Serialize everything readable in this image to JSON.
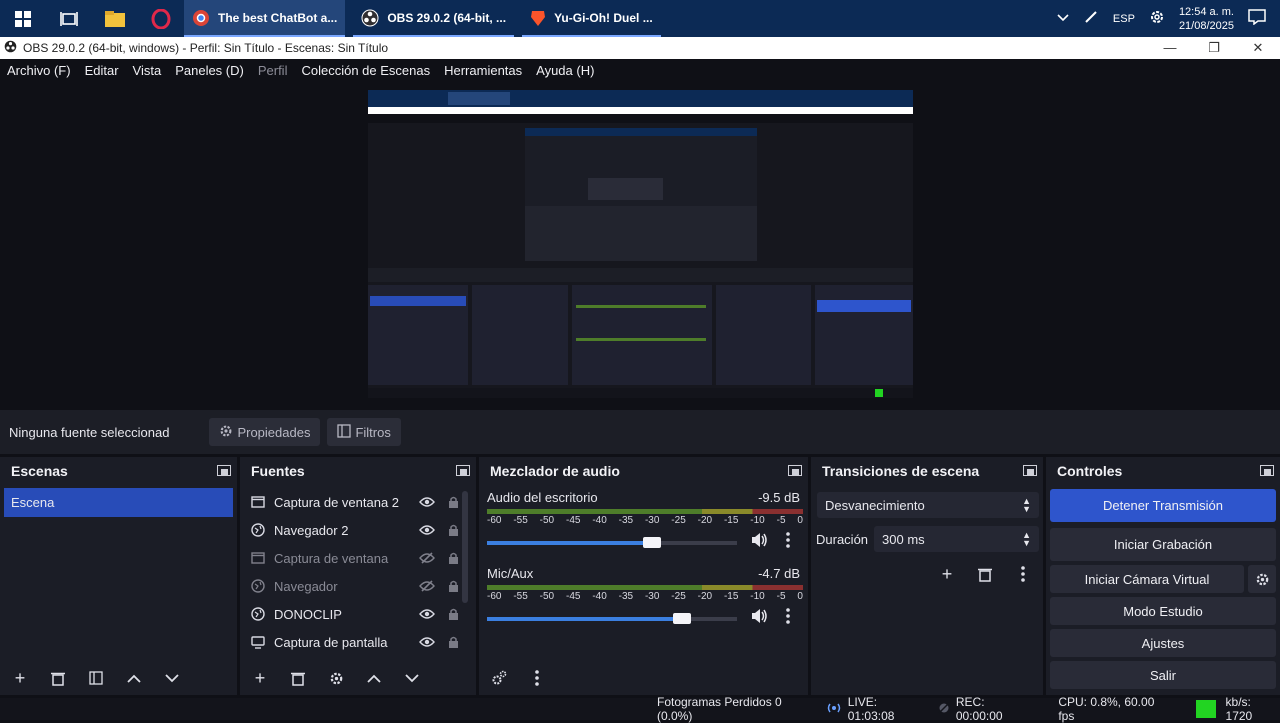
{
  "taskbar": {
    "tasks": [
      {
        "label": "The best ChatBot a..."
      },
      {
        "label": "OBS 29.0.2 (64-bit, ..."
      },
      {
        "label": "Yu-Gi-Oh! Duel ..."
      }
    ],
    "lang": "ESP",
    "time": "12:54 a. m.",
    "date": "21/08/2025"
  },
  "window": {
    "title": "OBS 29.0.2 (64-bit, windows) - Perfil: Sin Título - Escenas: Sin Título",
    "minimize": "—",
    "maximize": "❐",
    "close": "✕"
  },
  "menu": {
    "items": [
      {
        "label": "Archivo (F)"
      },
      {
        "label": "Editar"
      },
      {
        "label": "Vista"
      },
      {
        "label": "Paneles (D)"
      },
      {
        "label": "Perfil"
      },
      {
        "label": "Colección de Escenas"
      },
      {
        "label": "Herramientas"
      },
      {
        "label": "Ayuda (H)"
      }
    ]
  },
  "source_toolbar": {
    "no_source": "Ninguna fuente seleccionad",
    "properties": "Propiedades",
    "filters": "Filtros"
  },
  "scenes": {
    "title": "Escenas",
    "items": [
      {
        "label": "Escena"
      }
    ]
  },
  "sources": {
    "title": "Fuentes",
    "items": [
      {
        "label": "Captura de ventana 2",
        "icon": "window-capture-icon",
        "visible": true
      },
      {
        "label": "Navegador 2",
        "icon": "browser-icon",
        "visible": true
      },
      {
        "label": "Captura de ventana",
        "icon": "window-capture-icon",
        "visible": false
      },
      {
        "label": "Navegador",
        "icon": "browser-icon",
        "visible": false
      },
      {
        "label": "DONOCLIP",
        "icon": "browser-icon",
        "visible": true
      },
      {
        "label": "Captura de pantalla",
        "icon": "display-capture-icon",
        "visible": true
      }
    ]
  },
  "mixer": {
    "title": "Mezclador de audio",
    "ticks": [
      "-60",
      "-55",
      "-50",
      "-45",
      "-40",
      "-35",
      "-30",
      "-25",
      "-20",
      "-15",
      "-10",
      "-5",
      "0"
    ],
    "channels": [
      {
        "name": "Audio del escritorio",
        "db": "-9.5 dB",
        "level": 0.66
      },
      {
        "name": "Mic/Aux",
        "db": "-4.7 dB",
        "level": 0.78
      }
    ]
  },
  "transitions": {
    "title": "Transiciones de escena",
    "selected": "Desvanecimiento",
    "duration_label": "Duración",
    "duration_value": "300 ms"
  },
  "controls": {
    "title": "Controles",
    "stop_stream": "Detener Transmisión",
    "start_recording": "Iniciar Grabación",
    "start_virtualcam": "Iniciar Cámara Virtual",
    "studio_mode": "Modo Estudio",
    "settings": "Ajustes",
    "exit": "Salir"
  },
  "status": {
    "dropped": "Fotogramas Perdidos 0 (0.0%)",
    "live": "LIVE: 01:03:08",
    "rec": "REC: 00:00:00",
    "cpu": "CPU: 0.8%, 60.00 fps",
    "kbs": "kb/s: 1720"
  },
  "colors": {
    "accent": "#2e55cc",
    "taskbar": "#0c2a55",
    "status_ok": "#22d422"
  }
}
